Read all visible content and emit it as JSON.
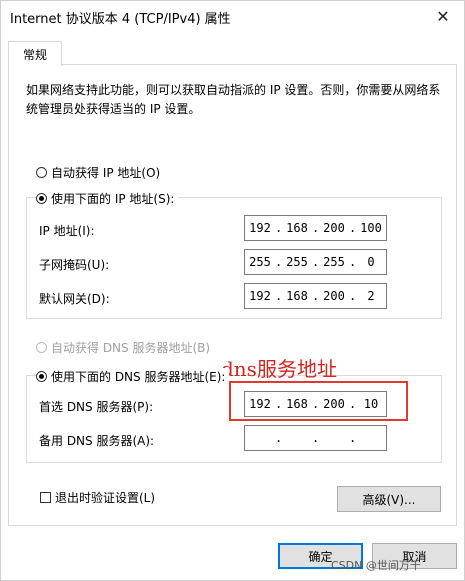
{
  "window": {
    "title": "Internet 协议版本 4 (TCP/IPv4) 属性",
    "close_glyph": "✕"
  },
  "tab": {
    "label": "常规"
  },
  "description": "如果网络支持此功能，则可以获取自动指派的 IP 设置。否则，你需要从网络系统管理员处获得适当的 IP 设置。",
  "ip_section": {
    "auto_label": "自动获得 IP 地址(O)",
    "manual_label": "使用下面的 IP 地址(S):",
    "fields": [
      {
        "label": "IP 地址(I):",
        "octets": [
          "192",
          "168",
          "200",
          "100"
        ]
      },
      {
        "label": "子网掩码(U):",
        "octets": [
          "255",
          "255",
          "255",
          "0"
        ]
      },
      {
        "label": "默认网关(D):",
        "octets": [
          "192",
          "168",
          "200",
          "2"
        ]
      }
    ]
  },
  "dns_section": {
    "auto_label": "自动获得 DNS 服务器地址(B)",
    "manual_label": "使用下面的 DNS 服务器地址(E):",
    "fields": [
      {
        "label": "首选 DNS 服务器(P):",
        "octets": [
          "192",
          "168",
          "200",
          "10"
        ]
      },
      {
        "label": "备用 DNS 服务器(A):",
        "octets": [
          "",
          "",
          "",
          ""
        ]
      }
    ]
  },
  "annotation": {
    "text": "dns服务地址",
    "color": "#d0261f"
  },
  "validate_label": "退出时验证设置(L)",
  "buttons": {
    "advanced": "高级(V)...",
    "ok": "确定",
    "cancel": "取消"
  },
  "watermark": "CSDN @世间万千",
  "colors": {
    "accent": "#0078d7",
    "annotation_red": "#e03a2f"
  }
}
